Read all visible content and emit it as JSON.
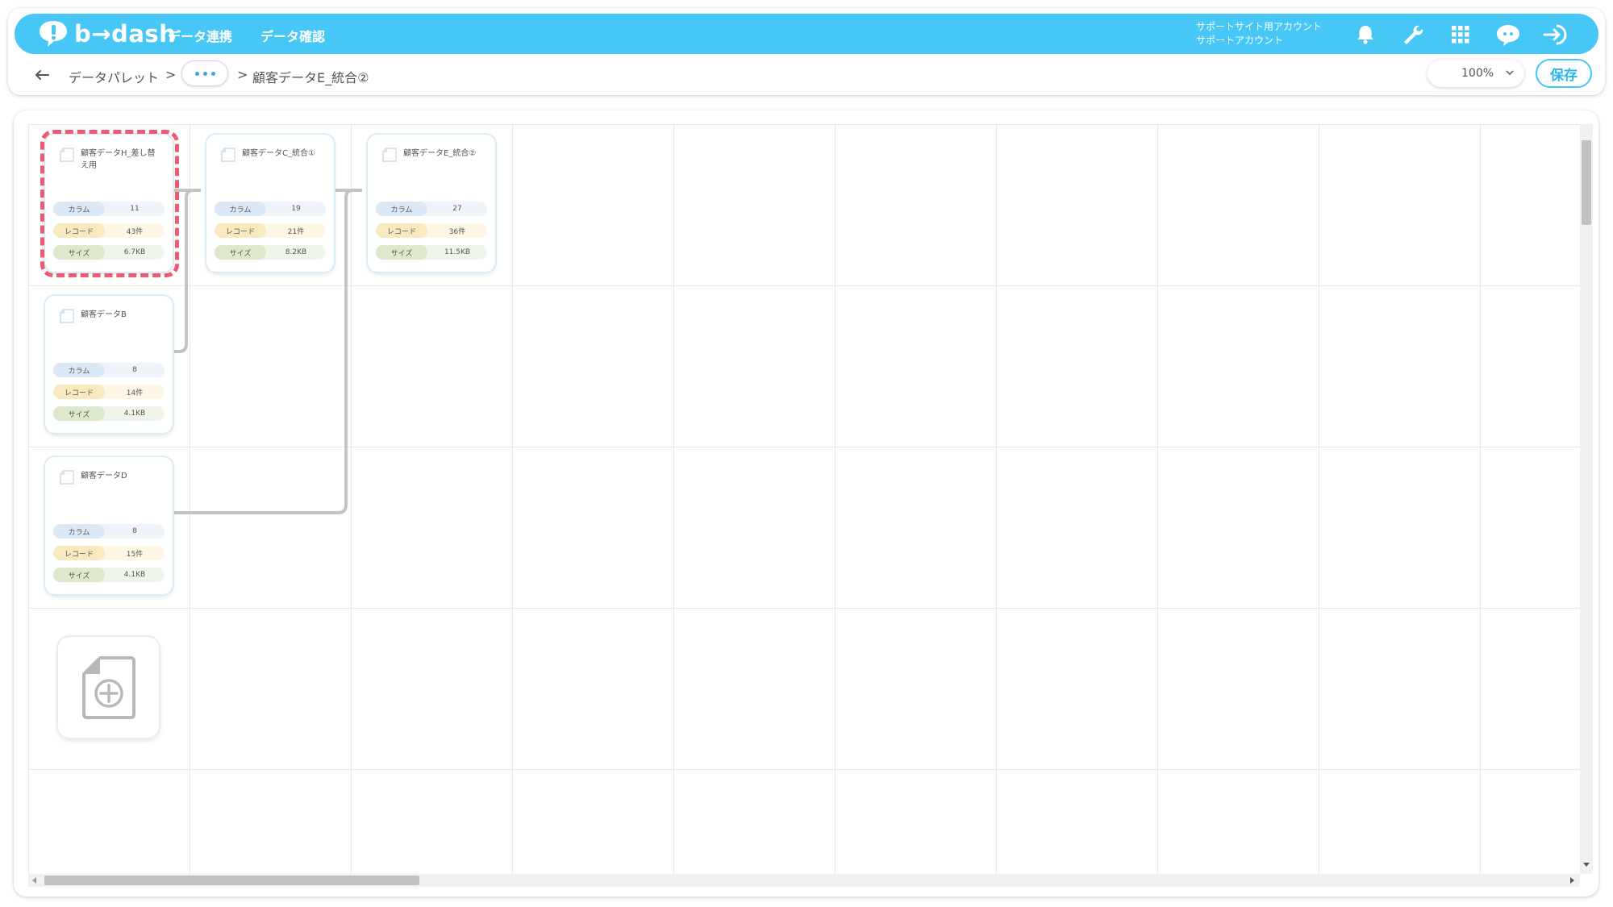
{
  "header": {
    "logo_text": "b→dash",
    "nav": [
      "データ連携",
      "データ確認"
    ],
    "account_line1": "サポートサイト用アカウント",
    "account_line2": "サポートアカウント",
    "icons": [
      "bell-icon",
      "wrench-icon",
      "apps-grid-icon",
      "chat-mascot-icon",
      "logout-icon"
    ],
    "accent_color": "#46c7f5"
  },
  "breadcrumb": {
    "root": "データパレット",
    "separator": ">",
    "more": "•••",
    "current": "顧客データE_統合②"
  },
  "toolbar": {
    "zoom": "100%",
    "save_label": "保存"
  },
  "labels": {
    "column": "カラム",
    "record": "レコード",
    "size": "サイズ"
  },
  "nodes": [
    {
      "title": "顧客データH_差し替え用",
      "columns": "11",
      "records": "43件",
      "size": "6.7KB",
      "selected": true
    },
    {
      "title": "顧客データC_統合①",
      "columns": "19",
      "records": "21件",
      "size": "8.2KB"
    },
    {
      "title": "顧客データE_統合②",
      "columns": "27",
      "records": "36件",
      "size": "11.5KB"
    },
    {
      "title": "顧客データB",
      "columns": "8",
      "records": "14件",
      "size": "4.1KB"
    },
    {
      "title": "顧客データD",
      "columns": "8",
      "records": "15件",
      "size": "4.1KB"
    }
  ],
  "colors": {
    "selection": "#ee5a72",
    "connector": "#c4c4c4"
  }
}
